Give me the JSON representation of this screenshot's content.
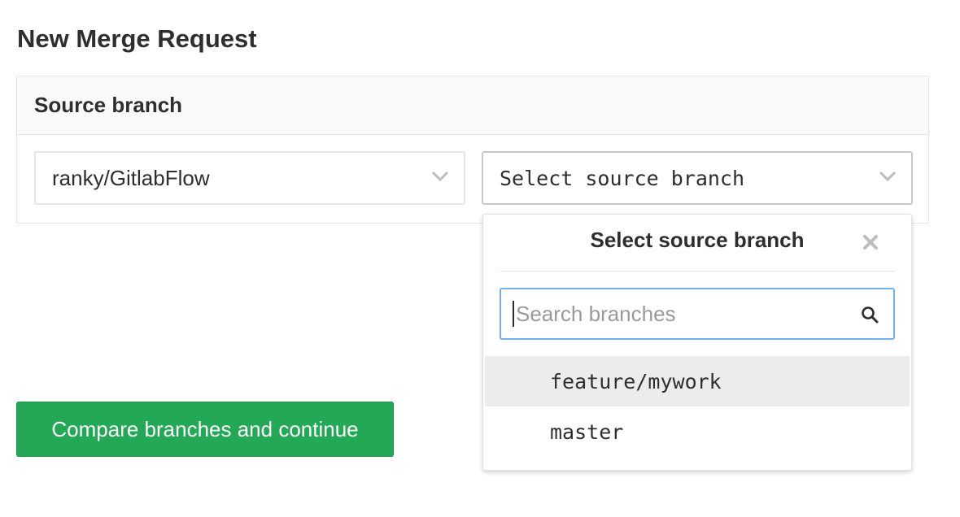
{
  "page": {
    "title": "New Merge Request"
  },
  "source_panel": {
    "header": "Source branch",
    "project_select": {
      "value": "ranky/GitlabFlow"
    },
    "branch_select": {
      "value": "Select source branch"
    }
  },
  "dropdown": {
    "title": "Select source branch",
    "search": {
      "placeholder": "Search branches",
      "value": ""
    },
    "items": [
      {
        "label": "feature/mywork",
        "highlighted": true
      },
      {
        "label": "master",
        "highlighted": false
      }
    ]
  },
  "actions": {
    "compare_label": "Compare branches and continue"
  },
  "colors": {
    "primary_green": "#23a955",
    "focus_blue": "#73afea",
    "highlight_row": "#ececec",
    "text": "#2e2e2e"
  },
  "icons": {
    "chevron": "chevron-down-icon",
    "close": "close-icon",
    "search": "search-icon"
  }
}
